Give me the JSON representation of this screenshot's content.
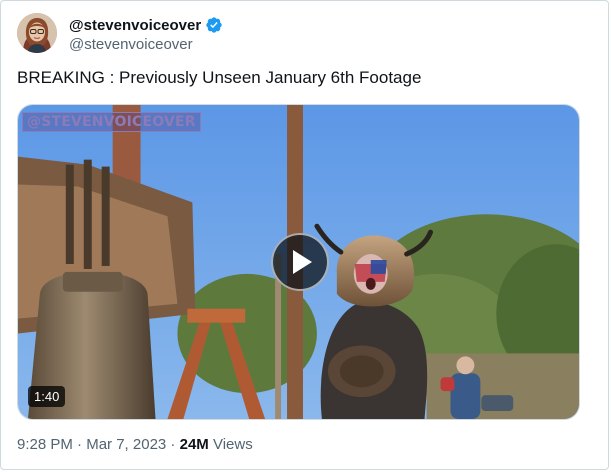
{
  "author": {
    "display_name": "@stevenvoiceover",
    "handle": "@stevenvoiceover",
    "verified": true,
    "verified_color": "#1d9bf0"
  },
  "tweet": {
    "text": "BREAKING : Previously Unseen January 6th Footage"
  },
  "media": {
    "watermark": "@STEVENVOICEOVER",
    "duration": "1:40"
  },
  "meta": {
    "time": "9:28 PM",
    "separator_1": " · ",
    "date": "Mar 7, 2023",
    "separator_2": " · ",
    "views_count": "24M",
    "views_label": " Views"
  }
}
